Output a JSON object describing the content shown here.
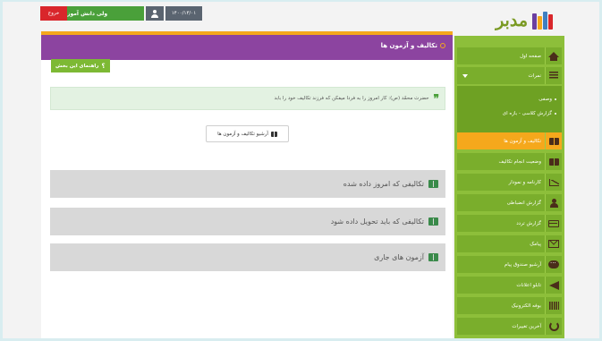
{
  "topbar": {
    "logo_text": "مدبر",
    "date": "۱۴۰۰/۱۴/۰۱",
    "user_name": "ولی دانش آموز",
    "logout_label": "خروج"
  },
  "colors": {
    "accent_orange": "#f5a81c",
    "header_purple": "#8c44a0",
    "sidebar_green": "#8dbf3a",
    "logout_red": "#d9262b",
    "user_green": "#4aa03a"
  },
  "main": {
    "title": "تکالیف و آزمون ها",
    "help_label": "راهنمای این بخش",
    "alert_text": "حضرت محمّد (ص): کار امروز را به فردا میفکن که فرزند تکالیف خود را بابد",
    "archive_label": "آرشیو تکالیف و آزمون ها",
    "panels": [
      {
        "label": "تکالیفی که امروز داده شده",
        "icon": "book-icon"
      },
      {
        "label": "تکالیفی که باید تحویل داده شود",
        "icon": "book-icon"
      },
      {
        "label": "آزمون های جاری",
        "icon": "book-icon"
      }
    ]
  },
  "sidebar": {
    "items": [
      {
        "label": "صفحه اول",
        "icon": "home-icon"
      },
      {
        "label": "نمرات",
        "icon": "list-icon"
      },
      {
        "label": "تکالیف و آزمون ها",
        "icon": "book-icon"
      },
      {
        "label": "وضعیت انجام تکالیف",
        "icon": "book-icon"
      },
      {
        "label": "کارنامه و نمودار",
        "icon": "chart-icon"
      },
      {
        "label": "گزارش انضباطی",
        "icon": "person-icon"
      },
      {
        "label": "گزارش تردد",
        "icon": "card-icon"
      },
      {
        "label": "پیامک",
        "icon": "mail-icon"
      },
      {
        "label": "آرشیو صندوق پیام",
        "icon": "bubble-icon"
      },
      {
        "label": "تابلو اعلانات",
        "icon": "send-icon"
      },
      {
        "label": "بوفه الکترونیک",
        "icon": "barcode-icon"
      },
      {
        "label": "آخرین تغییرات",
        "icon": "refresh-icon"
      }
    ],
    "submenu": [
      {
        "label": "وصفی"
      },
      {
        "label": "گزارش کلاسی - بازه ای"
      }
    ]
  }
}
